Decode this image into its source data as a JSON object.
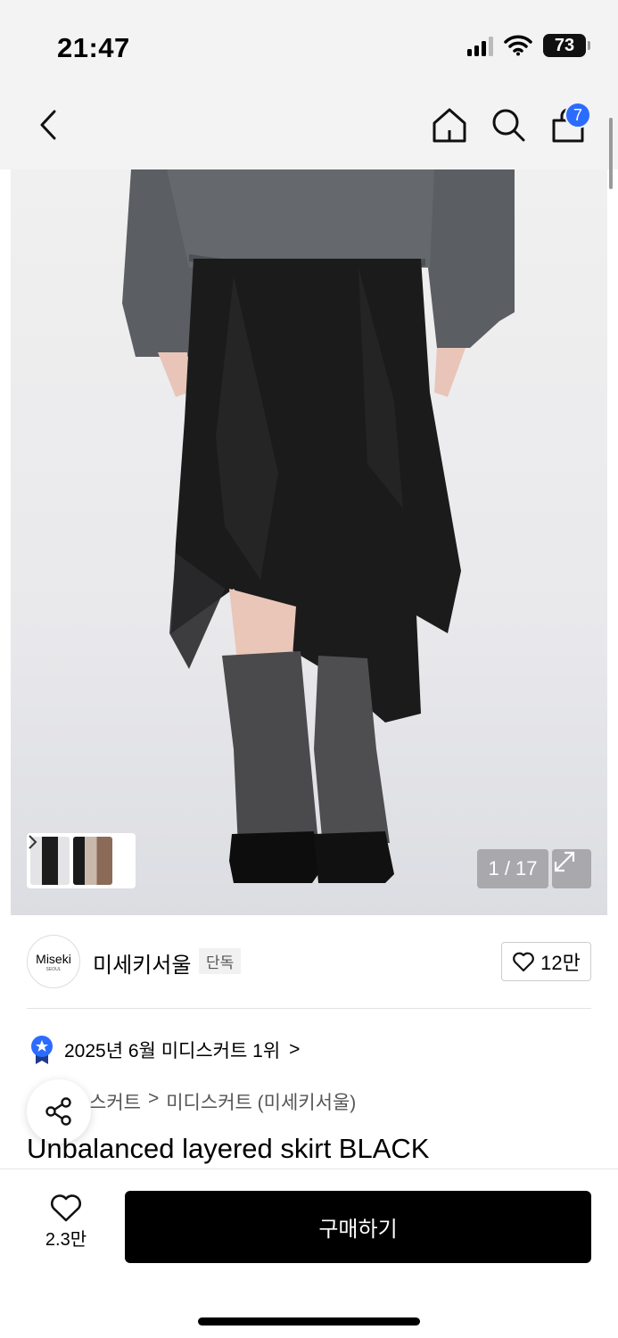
{
  "status_bar": {
    "time": "21:47",
    "battery": "73"
  },
  "nav": {
    "cart_count": "7"
  },
  "gallery": {
    "counter": "1 / 17"
  },
  "brand": {
    "logo_text": "Miseki",
    "logo_subtext": "SEOUL",
    "name": "미세키서울",
    "badge": "단독",
    "likes": "12만"
  },
  "ranking": {
    "text": "2025년 6월 미디스커트 1위",
    "chevron": ">"
  },
  "category": {
    "level1": "스커트",
    "separator": ">",
    "level2": "미디스커트 (미세키서울)"
  },
  "product": {
    "title": "Unbalanced layered skirt BLACK"
  },
  "bottom_bar": {
    "like_count": "2.3만",
    "buy_label": "구매하기"
  },
  "colors": {
    "accent_blue": "#2b6cff",
    "buy_button": "#000000"
  },
  "icons": [
    "back-icon",
    "home-icon",
    "search-icon",
    "bag-icon",
    "expand-icon",
    "heart-icon",
    "ranking-badge-icon",
    "share-icon",
    "chevron-right-icon"
  ]
}
